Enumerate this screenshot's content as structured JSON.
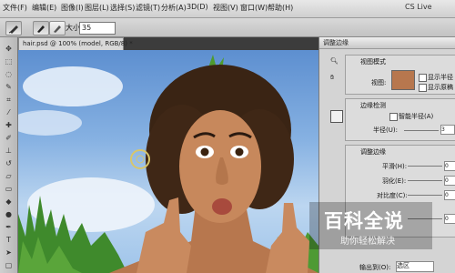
{
  "menubar": {
    "items": [
      "文件(F)",
      "编辑(E)",
      "图像(I)",
      "图层(L)",
      "选择(S)",
      "滤镜(T)",
      "分析(A)",
      "3D(D)",
      "视图(V)",
      "窗口(W)",
      "帮助(H)"
    ],
    "right_label": "CS Live"
  },
  "options_bar": {
    "size_label": "大小:",
    "size_value": "35"
  },
  "document": {
    "tab_title": "hair.psd @ 100% (model, RGB/8) *"
  },
  "dialog": {
    "title": "调整边缘",
    "view_mode_section": "视图模式",
    "view_label": "视图:",
    "show_radius_label": "显示半径",
    "show_original_label": "显示原稿",
    "edge_detection_section": "边缘检测",
    "smart_radius_label": "智能半径(A)",
    "radius_label": "半径(U):",
    "radius_value": "3",
    "adjust_edge_section": "调整边缘",
    "smooth_label": "平滑(H):",
    "smooth_value": "0",
    "feather_label": "羽化(E):",
    "feather_value": "0",
    "contrast_label": "对比度(C):",
    "contrast_value": "0",
    "shift_edge_value": "0",
    "output_to_label": "输出到(O):",
    "output_to_value": "选区"
  },
  "watermark": {
    "title": "百科全说",
    "subtitle": "助你轻松解决"
  }
}
